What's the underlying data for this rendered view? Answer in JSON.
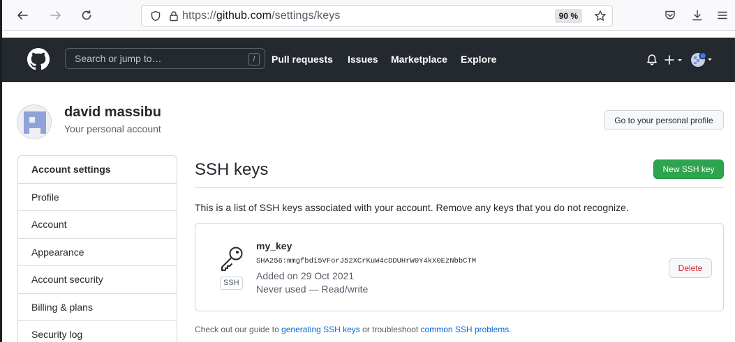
{
  "browser": {
    "url_prefix": "https://",
    "url_host": "github.com",
    "url_path": "/settings/keys",
    "zoom": "90 %"
  },
  "header": {
    "search_placeholder": "Search or jump to…",
    "slash_key": "/",
    "nav": [
      "Pull requests",
      "Issues",
      "Marketplace",
      "Explore"
    ]
  },
  "account": {
    "name": "david massibu",
    "subtitle": "Your personal account",
    "profile_button": "Go to your personal profile"
  },
  "sidebar": {
    "items": [
      {
        "label": "Account settings"
      },
      {
        "label": "Profile"
      },
      {
        "label": "Account"
      },
      {
        "label": "Appearance"
      },
      {
        "label": "Account security"
      },
      {
        "label": "Billing & plans"
      },
      {
        "label": "Security log"
      }
    ]
  },
  "main": {
    "title": "SSH keys",
    "new_button": "New SSH key",
    "intro": "This is a list of SSH keys associated with your account. Remove any keys that you do not recognize.",
    "key": {
      "badge": "SSH",
      "name": "my_key",
      "fingerprint": "SHA256:mmgfbdi5VForJ52XCrKuW4cDDUHrW0Y4kX0EzNbbCTM",
      "added": "Added on 29 Oct 2021",
      "usage": "Never used — Read/write",
      "delete_label": "Delete"
    },
    "footer": {
      "prefix": "Check out our guide to ",
      "link1": "generating SSH keys",
      "middle": " or troubleshoot ",
      "link2": "common SSH problems",
      "suffix": "."
    }
  },
  "colors": {
    "header_bg": "#24292f",
    "primary_green": "#2da44e",
    "danger_red": "#cf222e",
    "link_blue": "#0969da"
  }
}
